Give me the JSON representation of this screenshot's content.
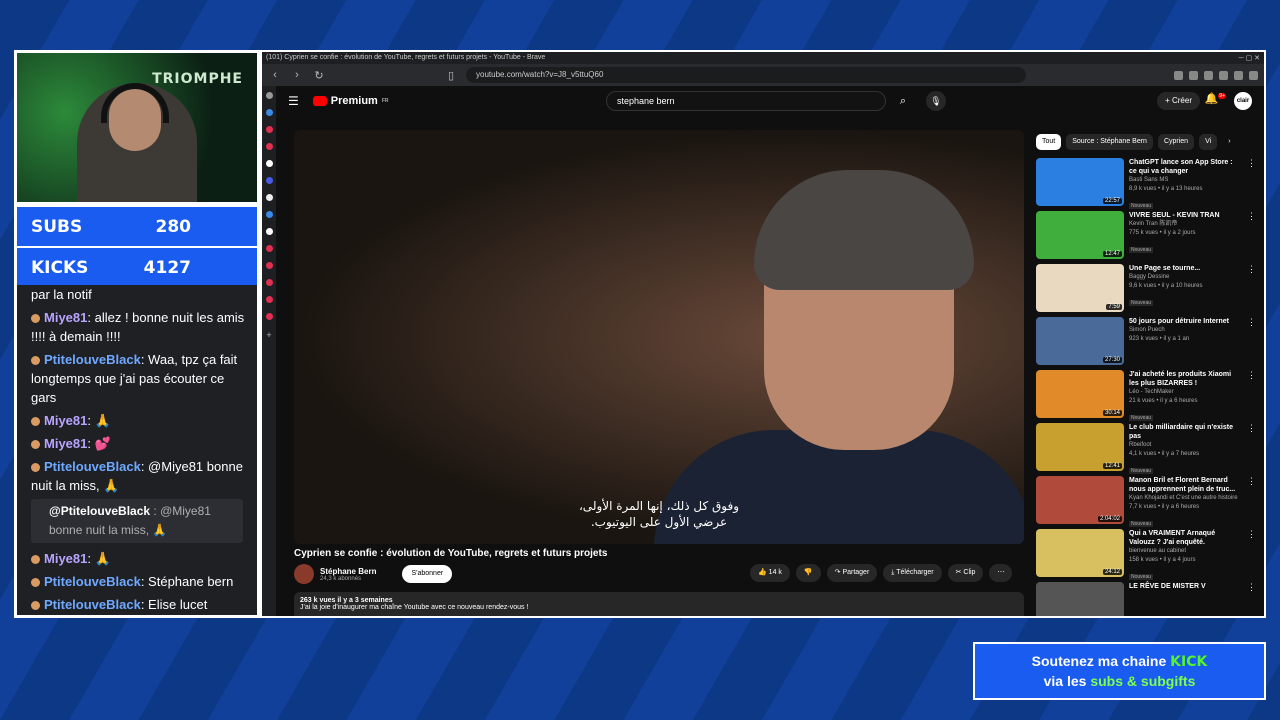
{
  "webcam": {
    "banner": "TRIOMPHE"
  },
  "stats": [
    {
      "label": "SUBS",
      "value": "280"
    },
    {
      "label": "KICKS",
      "value": "4127"
    }
  ],
  "chat": {
    "partial_line": "par la notif",
    "messages": [
      {
        "user": "Miye81",
        "text": ": allez ! bonne nuit les amis !!!! à demain !!!!",
        "color": "purple"
      },
      {
        "user": "PtitelouveBlack",
        "text": ": Waa, tpz ça fait longtemps que j'ai pas écouter ce gars",
        "color": "blue"
      },
      {
        "user": "Miye81",
        "text": ": 🙏",
        "color": "purple"
      },
      {
        "user": "Miye81",
        "text": ": 💕",
        "color": "purple"
      },
      {
        "user": "PtitelouveBlack",
        "text": ": @Miye81 bonne nuit la miss, 🙏",
        "color": "blue"
      }
    ],
    "reply": {
      "user": "@PtitelouveBlack",
      "mention": ": @Miye81",
      "text": "bonne nuit la miss, 🙏"
    },
    "messages2": [
      {
        "user": "Miye81",
        "text": ": 🙏",
        "color": "purple"
      },
      {
        "user": "PtitelouveBlack",
        "text": ": Stéphane bern",
        "color": "blue"
      },
      {
        "user": "PtitelouveBlack",
        "text": ": Elise lucet",
        "color": "blue"
      }
    ]
  },
  "browser": {
    "window_title": "(101) Cyprien se confie : évolution de YouTube, regrets et futurs projets - YouTube - Brave",
    "url": "youtube.com/watch?v=J8_v5ttuQ60"
  },
  "youtube": {
    "logo": "Premium",
    "logo_region": "FR",
    "search_value": "stephane bern",
    "create_label": "Créer",
    "notif_count": "9+",
    "avatar_text": "clair",
    "subtitle_line1": "وفوق كل ذلك، إنها المرة الأولى،",
    "subtitle_line2": "عرضي الأول على اليوتيوب.",
    "video_title": "Cyprien se confie : évolution de YouTube, regrets et futurs projets",
    "channel_name": "Stéphane Bern",
    "channel_subs": "24,3 k abonnés",
    "subscribe_label": "S'abonner",
    "likes": "14 k",
    "share_label": "Partager",
    "download_label": "Télécharger",
    "clip_label": "Clip",
    "desc_stats": "263 k vues  il y a 3 semaines",
    "desc_text": "J'ai la joie d'inaugurer ma chaîne Youtube avec ce nouveau rendez-vous !",
    "chips": [
      "Tout",
      "Source : Stéphane Bern",
      "Cyprien",
      "Vi"
    ],
    "related": [
      {
        "title": "ChatGPT lance son App Store : ce qui va changer",
        "channel": "Basti Sans MS",
        "meta": "8,9 k vues • il y a 13 heures",
        "badge": "Nouveau",
        "duration": "22:57",
        "color": "#2a7fe0"
      },
      {
        "title": "VIVRE SEUL - KEVIN TRAN",
        "channel": "Kevin Tran 陈凯帝",
        "meta": "775 k vues • il y a 2 jours",
        "badge": "Nouveau",
        "duration": "12:47",
        "color": "#3fae3c"
      },
      {
        "title": "Une Page se tourne...",
        "channel": "Baggy Dessine",
        "meta": "9,6 k vues • il y a 10 heures",
        "badge": "Nouveau",
        "duration": "7:59",
        "color": "#e8d9c0"
      },
      {
        "title": "50 jours pour détruire Internet",
        "channel": "Simon Puech",
        "meta": "923 k vues • il y a 1 an",
        "badge": "",
        "duration": "27:30",
        "color": "#4a6a9a"
      },
      {
        "title": "J'ai acheté les produits Xiaomi les plus BIZARRES !",
        "channel": "Léo - TechMaker",
        "meta": "21 k vues • il y a 6 heures",
        "badge": "Nouveau",
        "duration": "30:14",
        "color": "#e08a2a"
      },
      {
        "title": "Le club milliardaire qui n'existe pas",
        "channel": "Rbeifoot",
        "meta": "4,1 k vues • il y a 7 heures",
        "badge": "Nouveau",
        "duration": "12:41",
        "color": "#c8a030"
      },
      {
        "title": "Manon Bril et Florent Bernard nous apprennent plein de truc...",
        "channel": "Kyan Khojandi et C'est une autre histoire",
        "meta": "7,7 k vues • il y a 6 heures",
        "badge": "Nouveau",
        "duration": "2:04:02",
        "color": "#b04a3a"
      },
      {
        "title": "Qui a VRAIMENT Arnaqué Valouzz ? J'ai enquêté.",
        "channel": "bienvenue au cabinet",
        "meta": "158 k vues • il y a 4 jours",
        "badge": "Nouveau",
        "duration": "24:12",
        "color": "#d8c060"
      },
      {
        "title": "LE RÊVE DE MISTER V",
        "channel": "",
        "meta": "",
        "badge": "",
        "duration": "",
        "color": "#555555"
      }
    ]
  },
  "promo": {
    "line1": "Soutenez ma chaine",
    "brand": "KICK",
    "line2a": "via les",
    "line2b": "subs & subgifts"
  }
}
